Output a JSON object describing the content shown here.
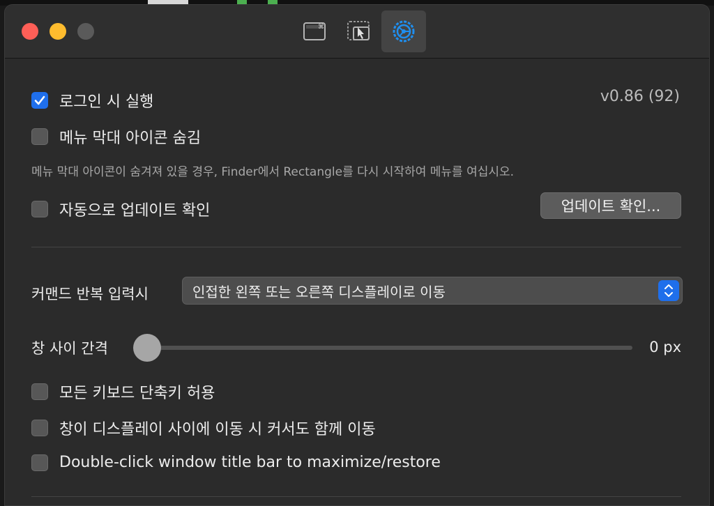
{
  "toolbar": {
    "tabs": [
      {
        "icon": "keyboard-shortcut-icon",
        "selected": false
      },
      {
        "icon": "snap-areas-icon",
        "selected": false
      },
      {
        "icon": "general-settings-icon",
        "selected": true
      }
    ]
  },
  "general": {
    "launch_on_login": {
      "label": "로그인 시 실행",
      "checked": true
    },
    "version": "v0.86 (92)",
    "hide_menubar_icon": {
      "label": "메뉴 막대 아이콘 숨김",
      "checked": false
    },
    "hint": "메뉴 막대 아이콘이 숨겨져 있을 경우, Finder에서 Rectangle를 다시 시작하여 메뉴를 여십시오.",
    "auto_update": {
      "label": "자동으로 업데이트 확인",
      "checked": false
    },
    "check_updates_button": "업데이트 확인..."
  },
  "behavior": {
    "repeat_command_label": "커맨드 반복 입력시",
    "repeat_command_value": "인접한 왼쪽 또는 오른쪽 디스플레이로 이동",
    "gap_label": "창 사이 간격",
    "gap_value": 0,
    "gap_value_text": "0 px",
    "allow_all_shortcuts": {
      "label": "모든 키보드 단축키 허용",
      "checked": false
    },
    "move_cursor": {
      "label": "창이 디스플레이 사이에 이동 시 커서도 함께 이동",
      "checked": false
    },
    "double_click_titlebar": {
      "label": "Double-click window title bar to maximize/restore",
      "checked": false
    }
  },
  "colors": {
    "accent": "#1f6feb",
    "close": "#ff5f57",
    "minimize": "#febc2e",
    "zoom_inactive": "#5a5a5a"
  }
}
